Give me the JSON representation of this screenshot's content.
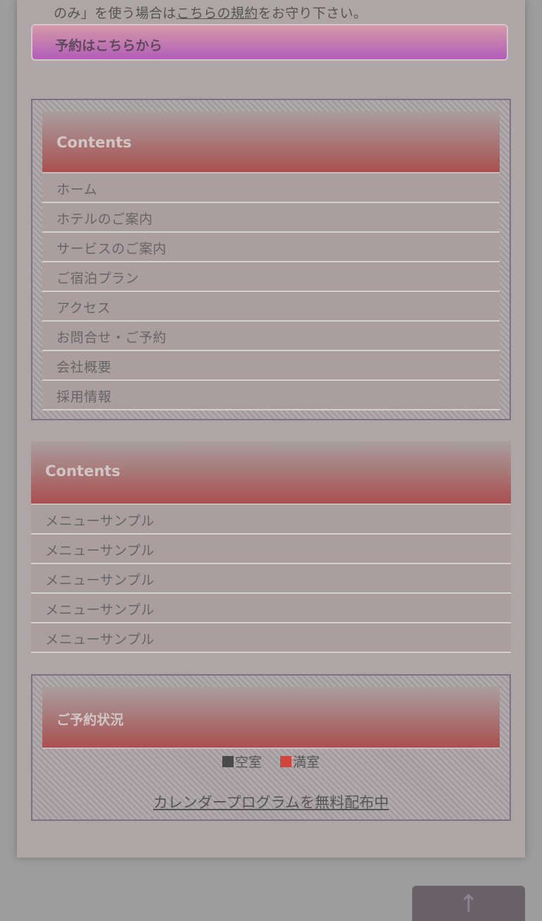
{
  "notice": {
    "prefix": "のみ」を使う場合は",
    "link": "こちらの規約",
    "suffix": "をお守り下さい。"
  },
  "reserve_button": "予約はこちらから",
  "contents_menu": {
    "heading": "Contents",
    "items": [
      "ホーム",
      "ホテルのご案内",
      "サービスのご案内",
      "ご宿泊プラン",
      "アクセス",
      "お問合せ・ご予約",
      "会社概要",
      "採用情報"
    ]
  },
  "sample_menu": {
    "heading": "Contents",
    "items": [
      "メニューサンプル",
      "メニューサンプル",
      "メニューサンプル",
      "メニューサンプル",
      "メニューサンプル"
    ]
  },
  "reservation_status": {
    "heading": "ご予約状況",
    "legend": [
      {
        "label": "空室",
        "color": "#4a4a4a"
      },
      {
        "label": "満室",
        "color": "#d0463f"
      }
    ],
    "calendar_link": "カレンダープログラムを無料配布中"
  },
  "to_top": {
    "icon": "arrow-up-icon",
    "glyph": "↑"
  }
}
